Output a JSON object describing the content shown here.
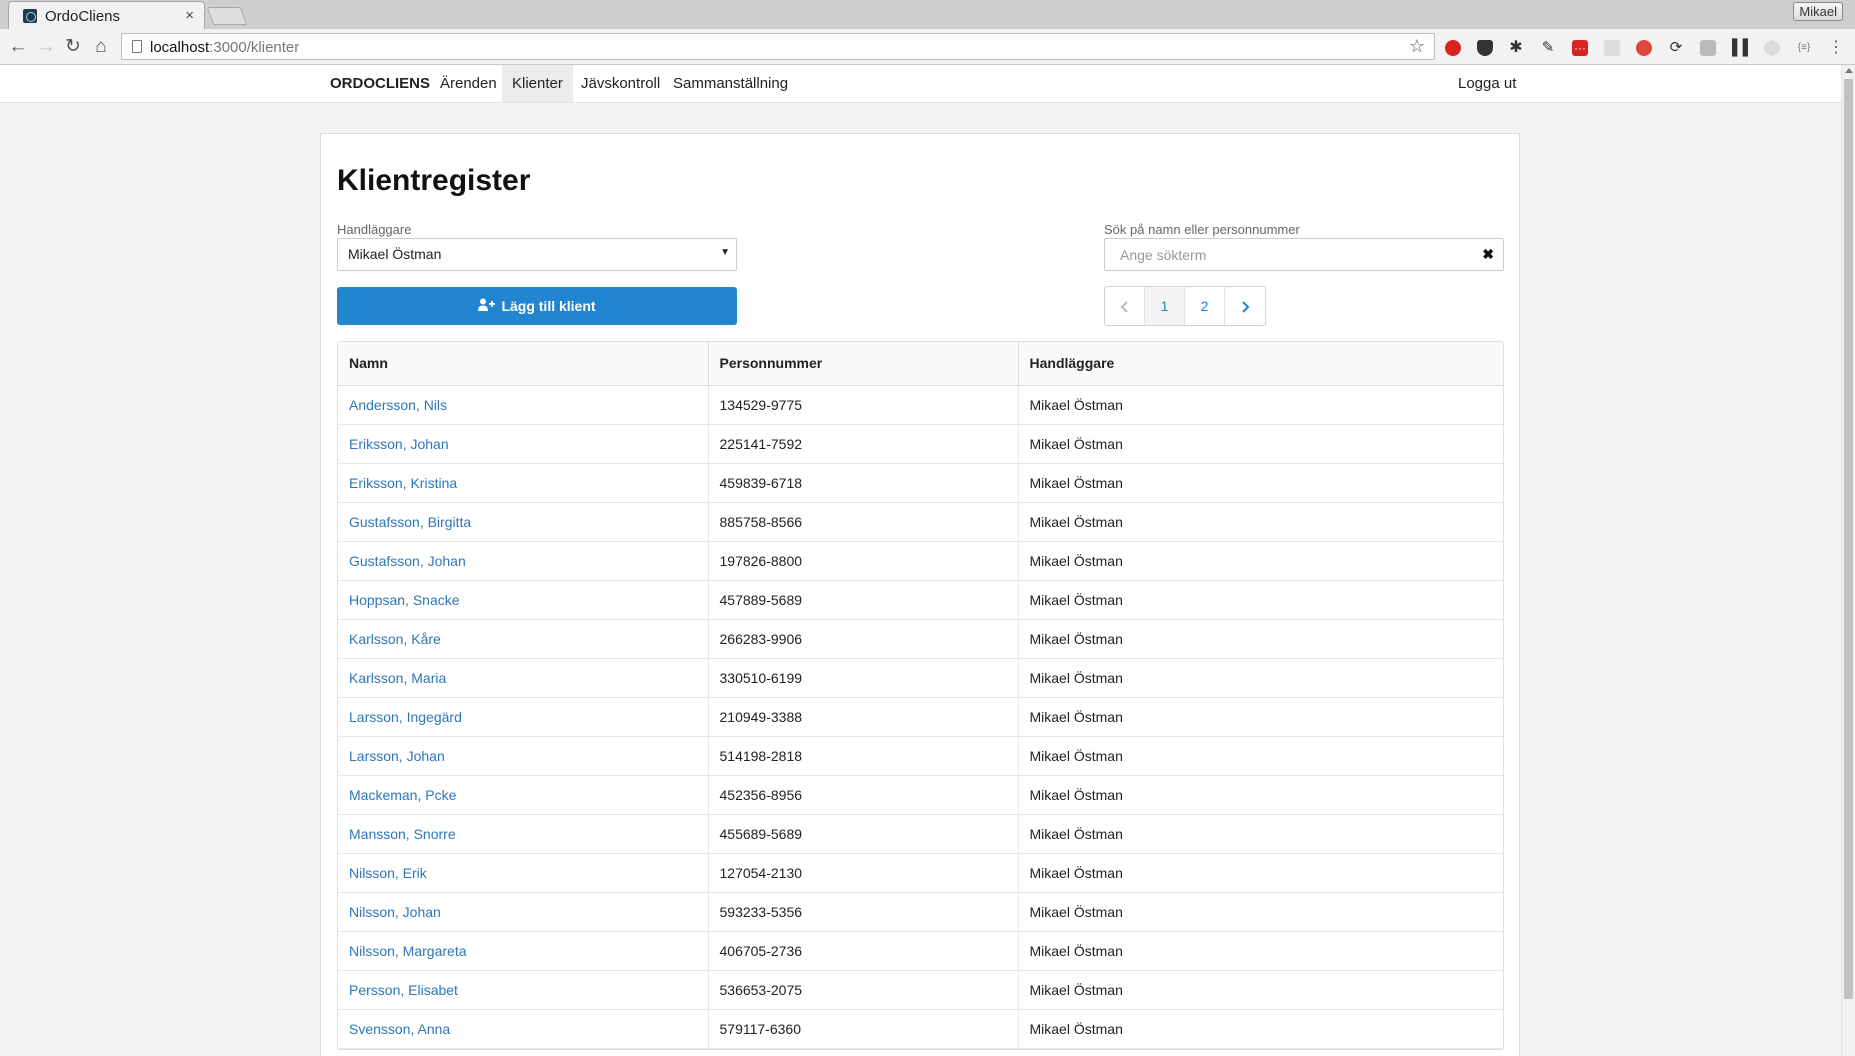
{
  "browser": {
    "tab_title": "OrdoCliens",
    "tab_close": "×",
    "profile_name": "Mikael",
    "url_host": "localhost",
    "url_path": ":3000/klienter",
    "back": "←",
    "forward": "→",
    "reload": "↻",
    "home": "⌂",
    "star": "☆",
    "menu": "⋮"
  },
  "navbar": {
    "brand": "ORDOCLIENS",
    "items": [
      {
        "label": "Ärenden",
        "active": false
      },
      {
        "label": "Klienter",
        "active": true
      },
      {
        "label": "Jävskontroll",
        "active": false
      },
      {
        "label": "Sammanställning",
        "active": false
      }
    ],
    "logout": "Logga ut"
  },
  "page": {
    "title": "Klientregister",
    "handler_label": "Handläggare",
    "handler_value": "Mikael Östman",
    "search_label": "Sök på namn eller personnummer",
    "search_placeholder": "Ange sökterm",
    "search_value": "",
    "clear_icon": "✖",
    "add_button": "Lägg till klient",
    "pagination": {
      "pages": [
        "1",
        "2"
      ],
      "current": "1"
    }
  },
  "table": {
    "columns": [
      "Namn",
      "Personnummer",
      "Handläggare"
    ],
    "rows": [
      [
        "Andersson, Nils",
        "134529-9775",
        "Mikael Östman"
      ],
      [
        "Eriksson, Johan",
        "225141-7592",
        "Mikael Östman"
      ],
      [
        "Eriksson, Kristina",
        "459839-6718",
        "Mikael Östman"
      ],
      [
        "Gustafsson, Birgitta",
        "885758-8566",
        "Mikael Östman"
      ],
      [
        "Gustafsson, Johan",
        "197826-8800",
        "Mikael Östman"
      ],
      [
        "Hoppsan, Snacke",
        "457889-5689",
        "Mikael Östman"
      ],
      [
        "Karlsson, Kåre",
        "266283-9906",
        "Mikael Östman"
      ],
      [
        "Karlsson, Maria",
        "330510-6199",
        "Mikael Östman"
      ],
      [
        "Larsson, Ingegärd",
        "210949-3388",
        "Mikael Östman"
      ],
      [
        "Larsson, Johan",
        "514198-2818",
        "Mikael Östman"
      ],
      [
        "Mackeman, Pcke",
        "452356-8956",
        "Mikael Östman"
      ],
      [
        "Mansson, Snorre",
        "455689-5689",
        "Mikael Östman"
      ],
      [
        "Nilsson, Erik",
        "127054-2130",
        "Mikael Östman"
      ],
      [
        "Nilsson, Johan",
        "593233-5356",
        "Mikael Östman"
      ],
      [
        "Nilsson, Margareta",
        "406705-2736",
        "Mikael Östman"
      ],
      [
        "Persson, Elisabet",
        "536653-2075",
        "Mikael Östman"
      ],
      [
        "Svensson, Anna",
        "579117-6360",
        "Mikael Östman"
      ]
    ]
  },
  "colors": {
    "primary": "#2185d0",
    "link": "#2e76b8"
  }
}
